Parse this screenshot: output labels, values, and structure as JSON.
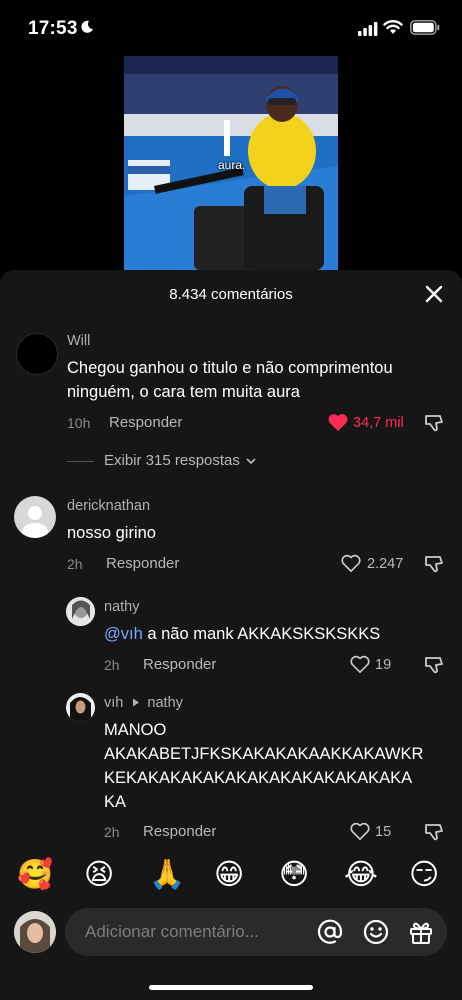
{
  "status_bar": {
    "time": "17:53"
  },
  "video": {
    "caption": "aura."
  },
  "sheet": {
    "title": "8.434 comentários"
  },
  "comments": [
    {
      "user": "Will",
      "text": "Chegou ganhou o titulo e não comprimentou ninguém, o cara tem muita aura",
      "time": "10h",
      "reply_label": "Responder",
      "likes": "34,7 mil",
      "liked": true,
      "view_replies": "Exibir 315 respostas"
    },
    {
      "user": "dericknathan",
      "text": "nosso girino",
      "time": "2h",
      "reply_label": "Responder",
      "likes": "2.247",
      "liked": false
    }
  ],
  "replies": [
    {
      "user": "nathy",
      "mention": "@vıh",
      "text": " a não mank AKKAKSKSKSKKS",
      "time": "2h",
      "reply_label": "Responder",
      "likes": "19"
    },
    {
      "user": "vıh",
      "reply_to": "nathy",
      "text_lines": [
        "MANOO",
        "AKAKABETJFKSKAKAKAKAAKKAKAWKR",
        "KEKAKAKAKAKAKAKAKAKAKAKAKAKA",
        "KA"
      ],
      "time": "2h",
      "reply_label": "Responder",
      "likes": "15"
    }
  ],
  "emoji_bar": [
    "🥰",
    "😫",
    "🙏",
    "😁",
    "😳",
    "😂",
    "😏"
  ],
  "composer": {
    "placeholder": "Adicionar comentário..."
  }
}
